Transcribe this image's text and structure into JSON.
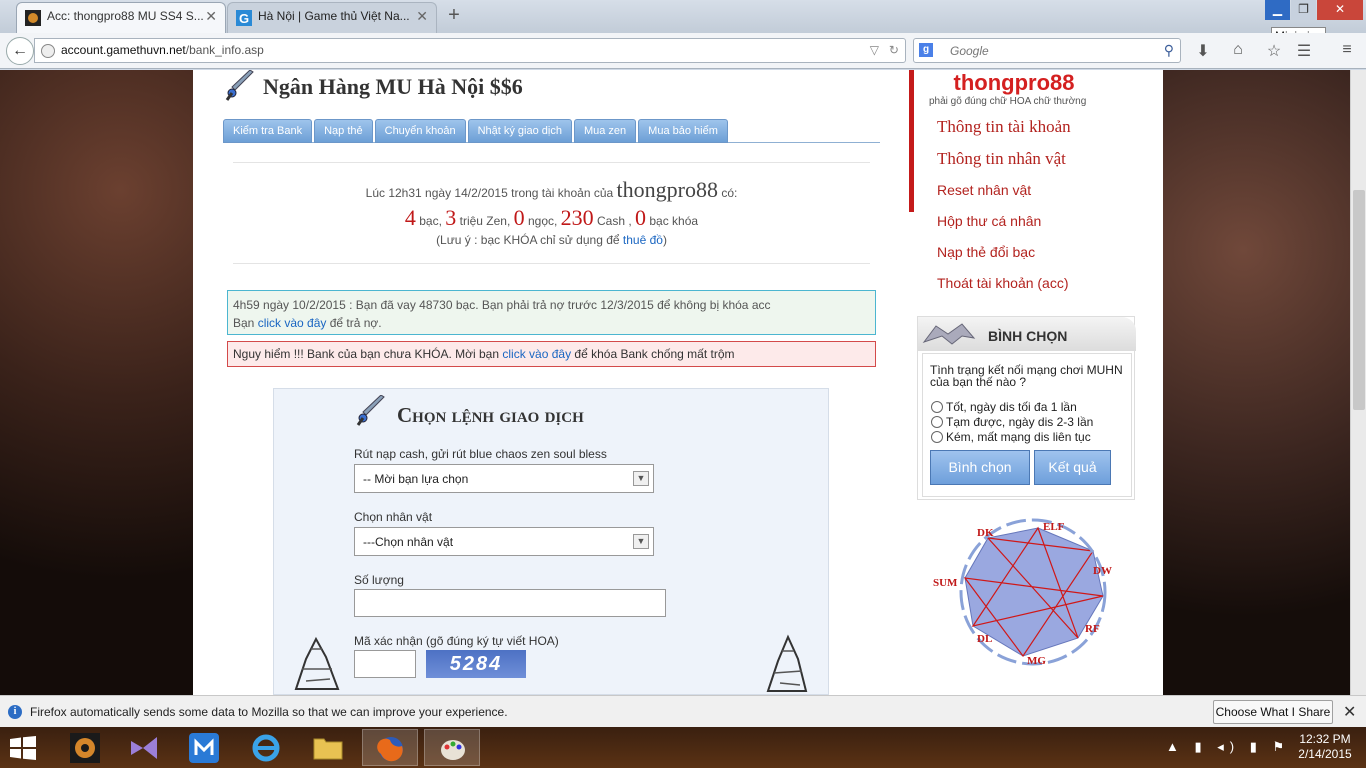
{
  "browser": {
    "tabs": [
      {
        "title": "Acc: thongpro88 MU SS4 S...",
        "close": "✕"
      },
      {
        "title": "Hà Nội | Game thủ Việt Na...",
        "close": "✕"
      }
    ],
    "new_tab": "+",
    "minimize_tooltip": "Minimize",
    "url_domain": "account.gamethuvn.net",
    "url_path": "/bank_info.asp",
    "search_placeholder": "Google"
  },
  "bank": {
    "title": "Ngân Hàng MU Hà Nội $$6",
    "tabs": [
      "Kiểm tra Bank",
      "Nạp thẻ",
      "Chuyển khoản",
      "Nhật ký giao dịch",
      "Mua zen",
      "Mua bảo hiểm"
    ],
    "line1_pre": "Lúc 12h31 ngày 14/2/2015 trong tài khoản của ",
    "line1_user": "thongpro88",
    "line1_post": " có:",
    "silver": "4",
    "silver_label": " bạc, ",
    "zen": "3",
    "zen_label": " triệu Zen, ",
    "jewel": "0",
    "jewel_label": " ngọc, ",
    "cash": "230",
    "cash_label": " Cash , ",
    "locked": "0",
    "locked_label": " bạc khóa",
    "note_pre": "(Lưu ý : bạc KHÓA chỉ sử dụng để ",
    "note_link": "thuê đồ",
    "note_post": ")"
  },
  "loan": {
    "line1": "4h59 ngày 10/2/2015 : Bạn đã vay 48730 bạc. Bạn phải trả nợ trước 12/3/2015 để không bị khóa acc",
    "line2_pre": "Bạn ",
    "line2_link": "click vào đây",
    "line2_post": " để trả nợ."
  },
  "warning": {
    "pre": "Nguy hiểm !!! Bank của bạn chưa KHÓA. Mời bạn ",
    "link": "click vào đây",
    "post": " để khóa Bank chống mất trộm"
  },
  "transaction": {
    "title": "Chọn lệnh giao dịch",
    "field1_label": "Rút nạp cash, gửi rút blue chaos zen soul bless",
    "field1_value": "-- Mời bạn lựa chọn",
    "field2_label": "Chọn nhân vật",
    "field2_value": "---Chọn nhân vật",
    "field3_label": "Số lượng",
    "captcha_label": "Mã xác nhận (gõ đúng ký tự viết HOA)",
    "captcha_text": "5284"
  },
  "sidebar": {
    "username": "thongpro88",
    "username_note": "phải gõ đúng chữ HOA chữ thường",
    "menu": [
      "Thông tin tài khoản",
      "Thông tin nhân vật",
      "Reset nhân vật",
      "Hộp thư cá nhân",
      "Nạp thẻ đổi bạc",
      "Thoát tài khoản (acc)"
    ]
  },
  "poll": {
    "title": "BÌNH CHỌN",
    "question": "Tình trạng kết nối mạng chơi MUHN của bạn thế nào ?",
    "options": [
      "Tốt, ngày dis tối đa 1 lần",
      "Tạm được, ngày dis 2-3 lần",
      "Kém, mất mạng dis liên tục"
    ],
    "vote_button": "Bình chọn",
    "result_button": "Kết quả"
  },
  "diagram": {
    "labels": [
      "ELF",
      "DW",
      "RF",
      "MG",
      "DL",
      "SUM",
      "DK"
    ]
  },
  "notification": {
    "text": "Firefox automatically sends some data to Mozilla so that we can improve your experience.",
    "button": "Choose What I Share",
    "close": "✕"
  },
  "taskbar": {
    "time": "12:32 PM",
    "date": "2/14/2015"
  },
  "colors": {
    "accent_red": "#c01818",
    "link_blue": "#1a66c2",
    "tab_blue": "#6d9fd6"
  }
}
